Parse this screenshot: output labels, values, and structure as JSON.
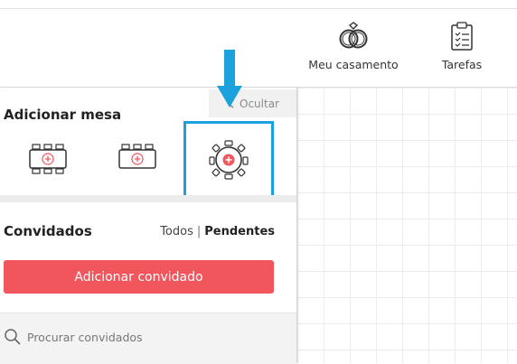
{
  "nav": {
    "wedding_label": "Meu casamento",
    "tasks_label": "Tarefas"
  },
  "panel": {
    "hide_label": "Ocultar",
    "add_table_title": "Adicionar mesa",
    "table_options": [
      {
        "icon": "rectangular-table-plus-icon"
      },
      {
        "icon": "banquet-table-plus-icon"
      },
      {
        "icon": "round-table-plus-icon"
      }
    ],
    "guests_title": "Convidados",
    "filter_all": "Todos",
    "filter_separator": "|",
    "filter_pending": "Pendentes",
    "add_guest_label": "Adicionar convidado",
    "search_placeholder": "Procurar convidados"
  },
  "colors": {
    "accent": "#f0565c",
    "highlight": "#1ba1db",
    "arrow": "#1ba1db"
  }
}
